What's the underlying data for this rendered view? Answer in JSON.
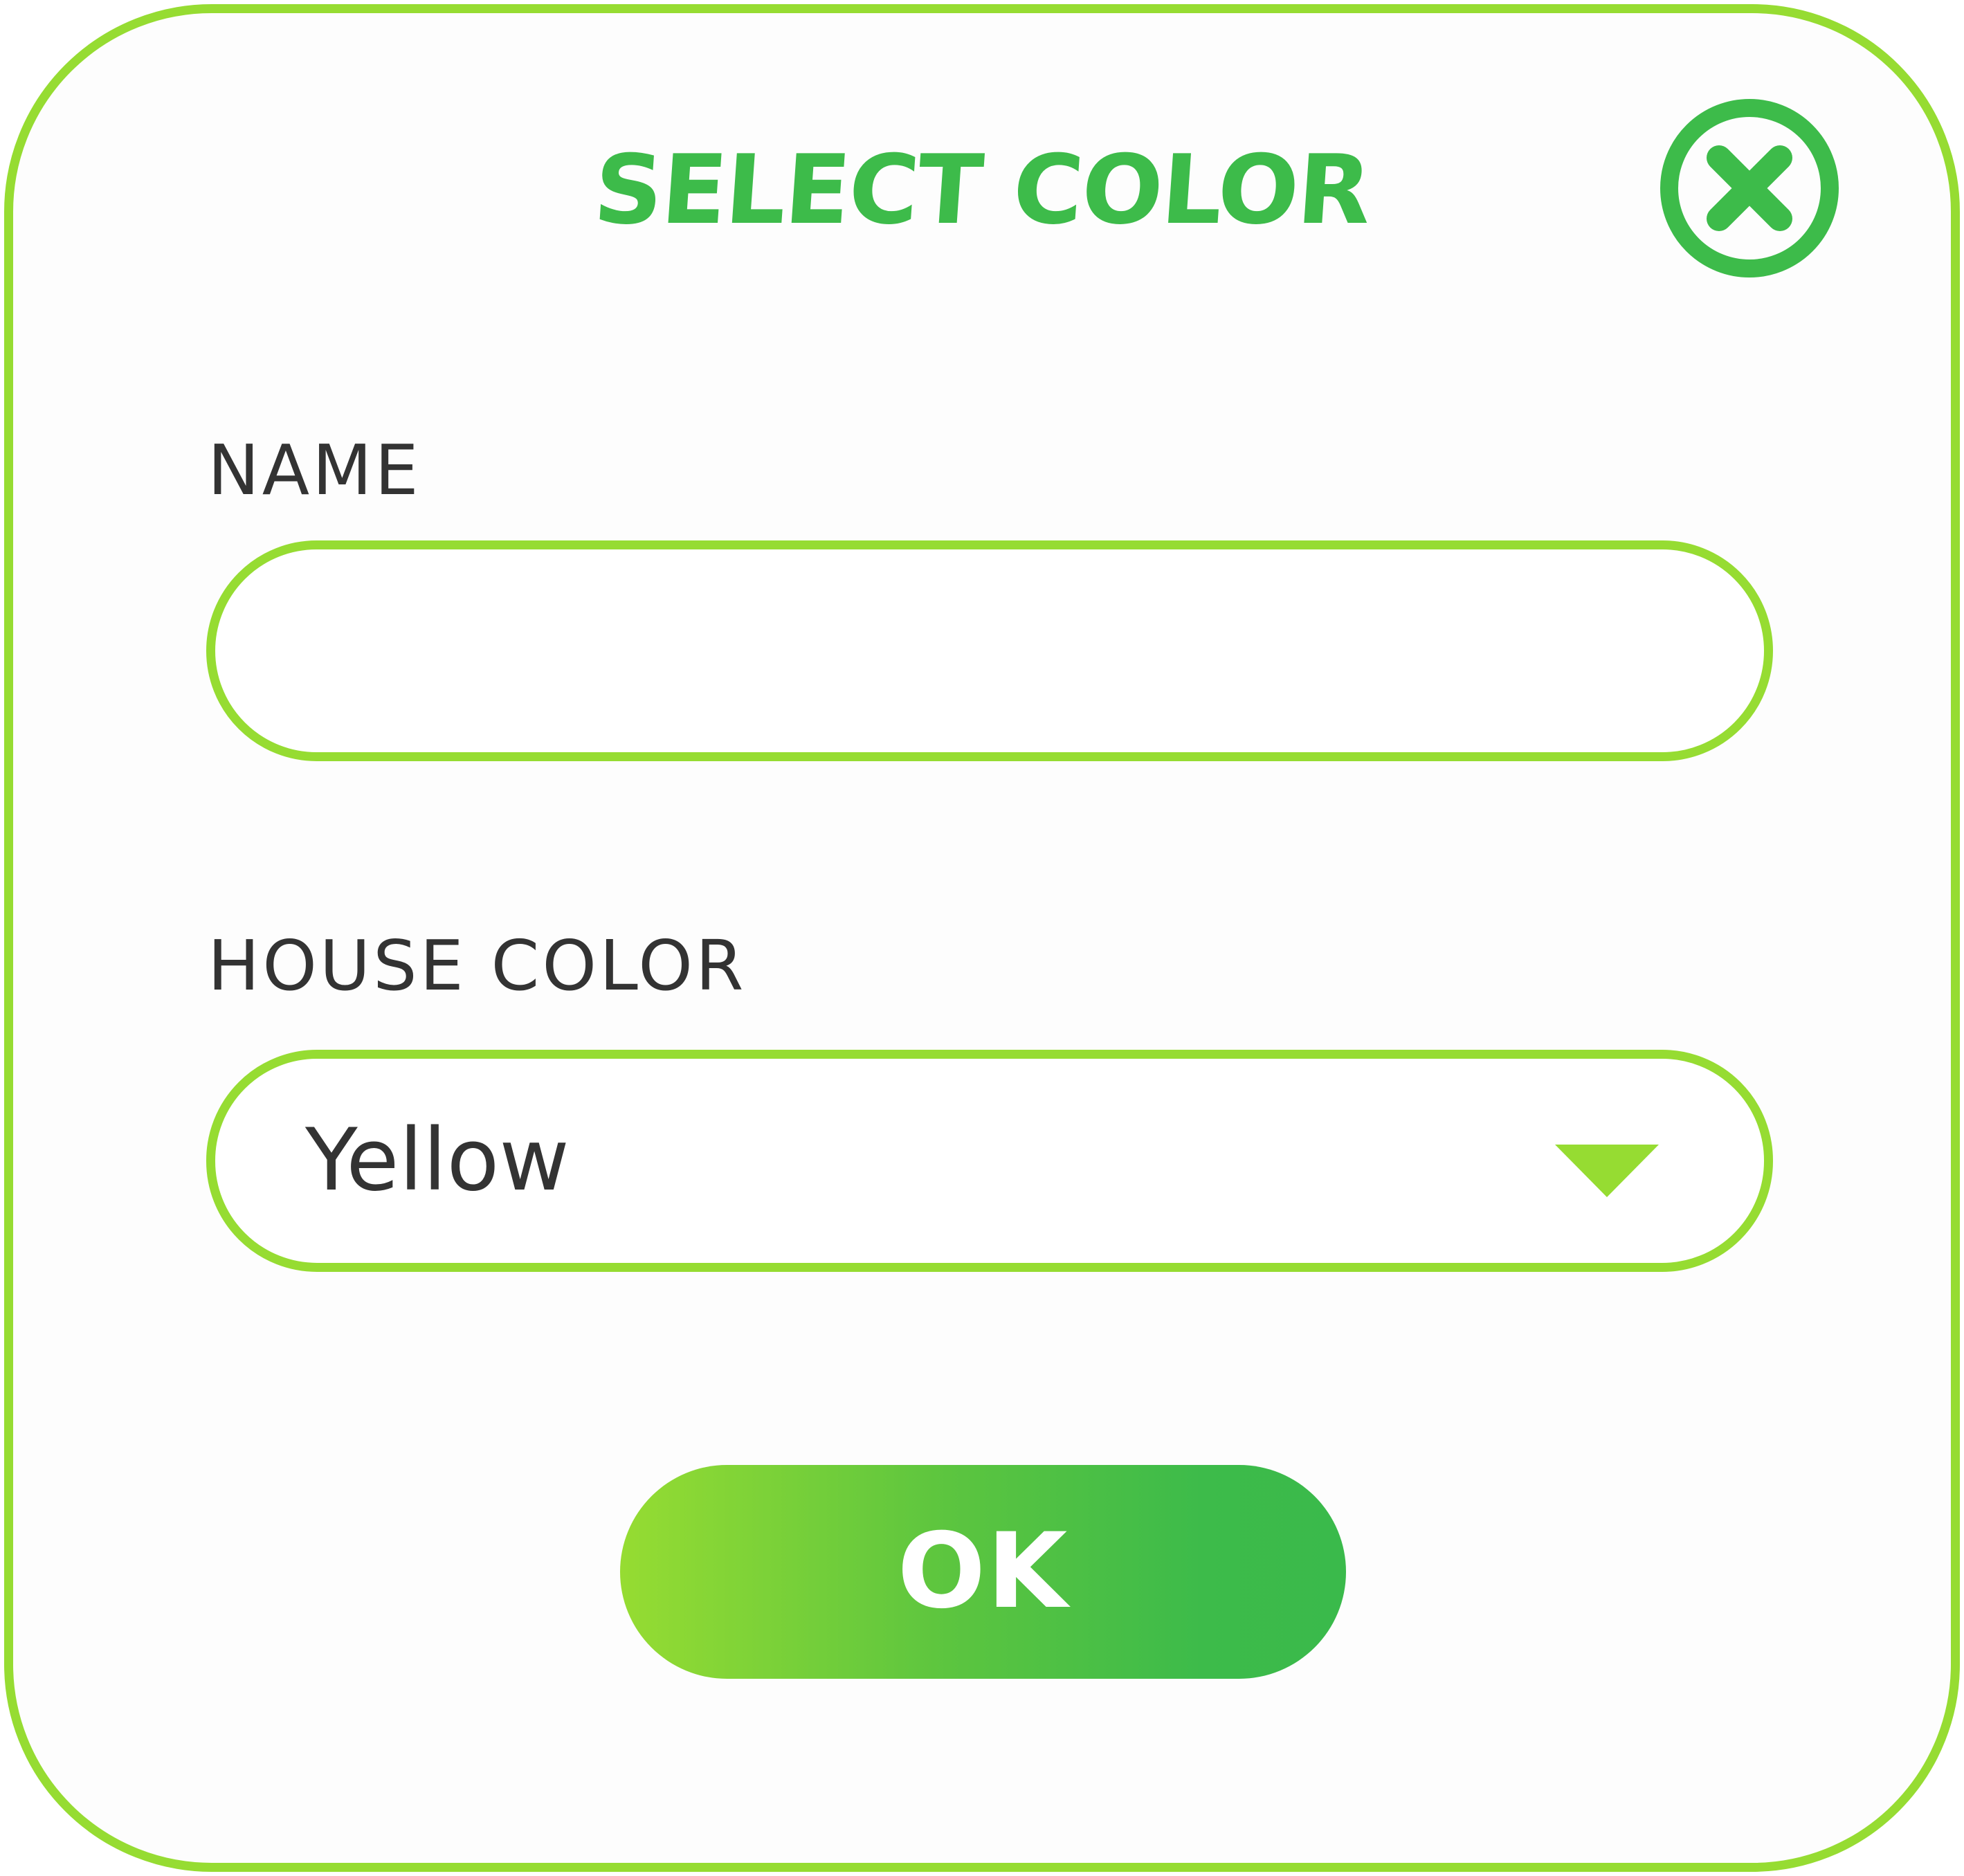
{
  "dialog": {
    "title": "SELECT COLOR",
    "close_icon": "close-circle-icon"
  },
  "name_field": {
    "label": "NAME",
    "value": "",
    "placeholder": ""
  },
  "house_color_field": {
    "label": "HOUSE COLOR",
    "selected_value": "Yellow",
    "arrow_icon": "triangle-down-icon"
  },
  "actions": {
    "ok_label": "OK"
  },
  "colors": {
    "border": "#96dc32",
    "title": "#3dbb4a",
    "text": "#333333",
    "button_gradient_start": "#96dc32",
    "button_gradient_end": "#3aba4b",
    "button_text": "#ffffff"
  }
}
